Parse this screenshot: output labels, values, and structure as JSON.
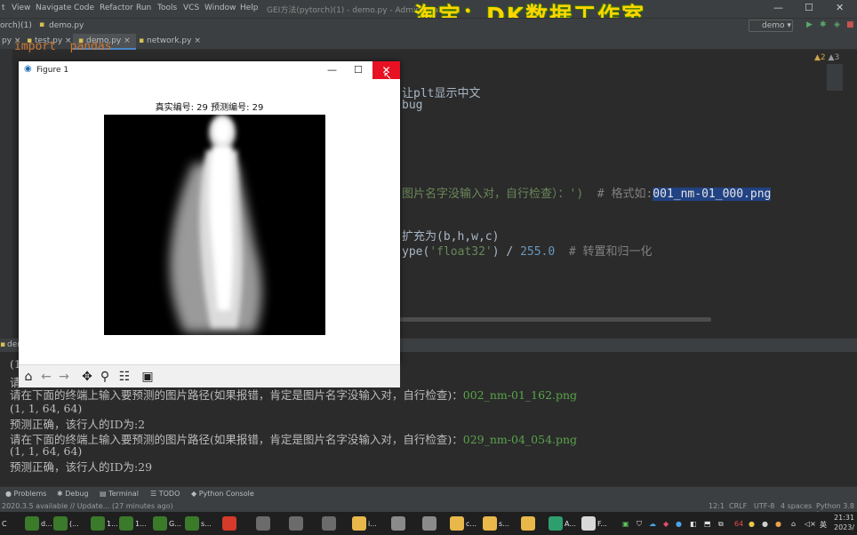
{
  "watermark": "淘宝：DK数据工作室",
  "window_title": "GEI方法(pytorch)(1) - demo.py - Administrator",
  "menu": [
    "t",
    "View",
    "Navigate",
    "Code",
    "Refactor",
    "Run",
    "Tools",
    "VCS",
    "Window",
    "Help"
  ],
  "nav": {
    "project": "orch)(1)",
    "file": "demo.py",
    "run_config": "demo"
  },
  "tabs": [
    {
      "label": "py"
    },
    {
      "label": "test.py"
    },
    {
      "label": "demo.py"
    },
    {
      "label": "network.py"
    }
  ],
  "inspection": {
    "warnings": "▲2",
    "weak": "▲3"
  },
  "code_lines": {
    "l1": "import  pandas",
    "l2_tail": "让plt显示中文",
    "l3_tail": "bug",
    "l4_a": "图片名字没输入对，自行检查）：')",
    "l4_b": "  # 格式如:",
    "l4_sel": "001_nm-01_000.png",
    "l5": "扩充为(b,h,w,c)",
    "l6_a": "ype(",
    "l6_str": "'float32'",
    "l6_b": ") / ",
    "l6_num": "255.0",
    "l6_cm": "  # 转置和归一化"
  },
  "run_tab": "dem",
  "console": [
    {
      "text": "(1",
      "green": ""
    },
    {
      "text": "请",
      "green": ""
    },
    {
      "text": "请在下面的终端上输入要预测的图片路径(如果报错，肯定是图片名字没输入对，自行检查)：",
      "green": "002_nm-01_162.png"
    },
    {
      "text": "(1, 1, 64, 64)",
      "green": ""
    },
    {
      "text": "预测正确，该行人的ID为:2",
      "green": ""
    },
    {
      "text": "请在下面的终端上输入要预测的图片路径(如果报错，肯定是图片名字没输入对，自行检查)：",
      "green": "029_nm-04_054.png"
    },
    {
      "text": "(1, 1, 64, 64)",
      "green": ""
    },
    {
      "text": "预测正确，该行人的ID为:29",
      "green": ""
    }
  ],
  "tool_windows": [
    "Problems",
    "Debug",
    "Terminal",
    "TODO",
    "Python Console"
  ],
  "status": {
    "message": "2020.3.5 available // Update... (27 minutes ago)",
    "position": "12:1",
    "line_sep": "CRLF",
    "encoding": "UTF-8",
    "indent": "4 spaces",
    "interpreter": "Python 3.8 ("
  },
  "figure": {
    "title": "Figure 1",
    "heading": "真实编号: 29      预测编号: 29"
  },
  "taskbar": {
    "time": "21:31",
    "date": "2023/",
    "lang": "英",
    "items": [
      "C",
      "d...",
      "(...",
      "1...",
      "G...",
      "s...",
      "i...",
      "c...",
      "s...",
      "A...",
      "F..."
    ]
  }
}
